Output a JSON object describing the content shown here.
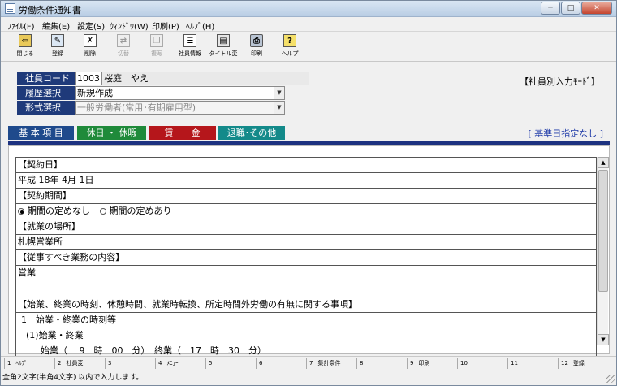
{
  "window": {
    "title": "労働条件通知書",
    "minimize": "─",
    "maximize": "□",
    "close": "✕"
  },
  "menu": [
    {
      "label": "ﾌｧｲﾙ(F)"
    },
    {
      "label": "編集(E)"
    },
    {
      "label": "設定(S)"
    },
    {
      "label": "ｳｨﾝﾄﾞｳ(W)"
    },
    {
      "label": "印刷(P)"
    },
    {
      "label": "ﾍﾙﾌﾟ(H)"
    }
  ],
  "toolbar": [
    {
      "label": "閉じる",
      "icon": "exit-icon",
      "enabled": true
    },
    {
      "label": "登録",
      "icon": "register-icon",
      "enabled": true
    },
    {
      "label": "削除",
      "icon": "delete-icon",
      "enabled": true
    },
    {
      "label": "切替",
      "icon": "switch-icon",
      "enabled": false
    },
    {
      "label": "複写",
      "icon": "copy-icon",
      "enabled": false
    },
    {
      "label": "社員情報",
      "icon": "employee-info-icon",
      "enabled": true
    },
    {
      "label": "タイトル変",
      "icon": "title-change-icon",
      "enabled": true
    },
    {
      "label": "印刷",
      "icon": "printer-icon",
      "enabled": true
    },
    {
      "label": "ヘルプ",
      "icon": "help-icon",
      "enabled": true
    }
  ],
  "header": {
    "employee_code_label": "社員コード",
    "employee_code": "1003",
    "employee_name": "桜庭　やえ",
    "history_label": "履歴選択",
    "history_value": "新規作成",
    "format_label": "形式選択",
    "format_value": "一般労働者(常用･有期雇用型)",
    "mode": "【社員別入力ﾓｰﾄﾞ】"
  },
  "tabs": [
    {
      "label": "基 本 項 目",
      "color": "#1f4a8c"
    },
    {
      "label": "休日 ・ 休暇",
      "color": "#1f8a3a"
    },
    {
      "label": "賃　　金",
      "color": "#b5161b"
    },
    {
      "label": "退職･その他",
      "color": "#138a8a"
    }
  ],
  "base_date_label": "[ 基準日指定なし ]",
  "form": {
    "contract_date_label": "【契約日】",
    "contract_date": "平成 18年 4月 1日",
    "contract_period_label": "【契約期間】",
    "period_option_none": "期間の定めなし",
    "period_option_fixed": "期間の定めあり",
    "workplace_label": "【就業の場所】",
    "workplace": "札幌営業所",
    "duties_label": "【従事すべき業務の内容】",
    "duties": "営業",
    "hours_label": "【始業、終業の時刻、休憩時間、就業時転換、所定時間外労働の有無に関する事項】",
    "hours_line1": "1　始業・終業の時刻等",
    "hours_line2": "(1)始業・終業",
    "hours_line3": "始業（　 9　時　00　分）　終業（　17　時　30　分）"
  },
  "fkeys": [
    {
      "n": "1",
      "label": "ﾍﾙﾌﾟ"
    },
    {
      "n": "2",
      "label": "社員変"
    },
    {
      "n": "3",
      "label": ""
    },
    {
      "n": "4",
      "label": "ﾒﾆｭｰ"
    },
    {
      "n": "5",
      "label": ""
    },
    {
      "n": "6",
      "label": ""
    },
    {
      "n": "7",
      "label": "集計条件"
    },
    {
      "n": "8",
      "label": ""
    },
    {
      "n": "9",
      "label": "印刷"
    },
    {
      "n": "10",
      "label": ""
    },
    {
      "n": "11",
      "label": ""
    },
    {
      "n": "12",
      "label": "登録"
    }
  ],
  "status": "全角2文字(半角4文字) 以内で入力します。"
}
